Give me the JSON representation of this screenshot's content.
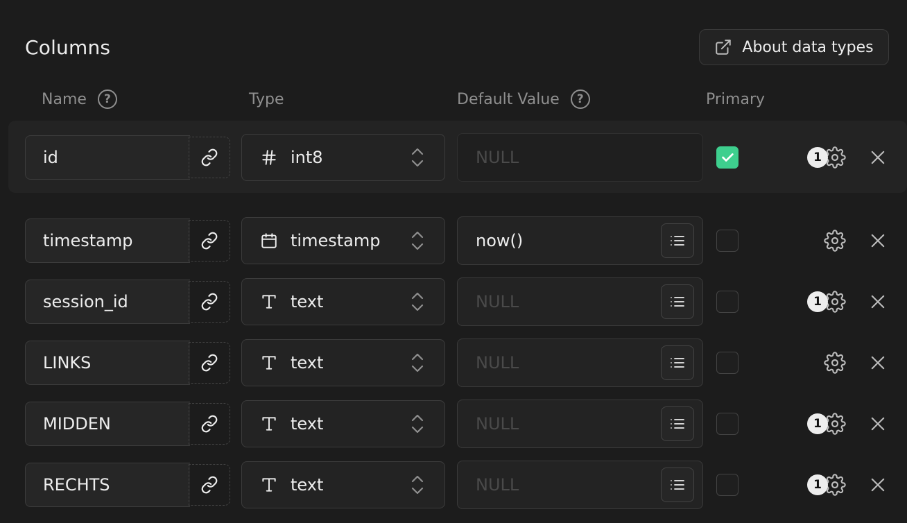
{
  "title": "Columns",
  "about_button": {
    "label": "About data types",
    "icon": "external-link-icon"
  },
  "headers": {
    "name": "Name",
    "type": "Type",
    "default_value": "Default Value",
    "primary": "Primary",
    "help_symbol": "?"
  },
  "rows": [
    {
      "name": "id",
      "type": "int8",
      "type_icon": "hash-icon",
      "default": "NULL",
      "default_is_placeholder": true,
      "has_list_button": false,
      "primary": true,
      "badge": "1"
    },
    {
      "name": "timestamp",
      "type": "timestamp",
      "type_icon": "calendar-icon",
      "default": "now()",
      "default_is_placeholder": false,
      "has_list_button": true,
      "primary": false,
      "badge": ""
    },
    {
      "name": "session_id",
      "type": "text",
      "type_icon": "text-type-icon",
      "default": "NULL",
      "default_is_placeholder": true,
      "has_list_button": true,
      "primary": false,
      "badge": "1"
    },
    {
      "name": "LINKS",
      "type": "text",
      "type_icon": "text-type-icon",
      "default": "NULL",
      "default_is_placeholder": true,
      "has_list_button": true,
      "primary": false,
      "badge": ""
    },
    {
      "name": "MIDDEN",
      "type": "text",
      "type_icon": "text-type-icon",
      "default": "NULL",
      "default_is_placeholder": true,
      "has_list_button": true,
      "primary": false,
      "badge": "1"
    },
    {
      "name": "RECHTS",
      "type": "text",
      "type_icon": "text-type-icon",
      "default": "NULL",
      "default_is_placeholder": true,
      "has_list_button": true,
      "primary": false,
      "badge": "1"
    }
  ],
  "colors": {
    "background": "#1c1c1c",
    "accent": "#3ecf8e",
    "muted": "#8f8f8f"
  }
}
